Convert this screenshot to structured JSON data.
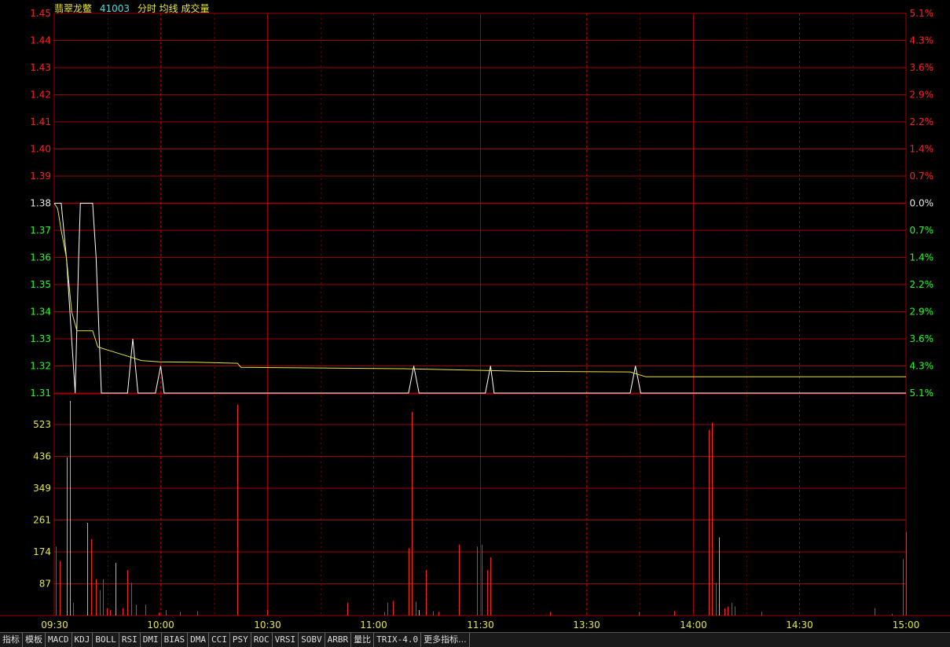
{
  "header": {
    "stock_name": "翡翠龙鳖",
    "stock_code": "41003",
    "legend_label": "分时 均线 成交量"
  },
  "colors": {
    "grid": "#a00000",
    "price_line": "#ffffff",
    "avg_line": "#e6e640",
    "up": "#ff2020",
    "down": "#20ff20",
    "neutral": "#e8e8e8",
    "volume_up": "#ff2020",
    "volume_down": "#40e0e0",
    "volume_label": "#e6e640",
    "time_label": "#e6e640"
  },
  "chart_data": [
    {
      "type": "line",
      "name": "price",
      "y_ticks_left": [
        "1.45",
        "1.44",
        "1.43",
        "1.42",
        "1.41",
        "1.40",
        "1.39",
        "1.38",
        "1.37",
        "1.36",
        "1.35",
        "1.34",
        "1.33",
        "1.32",
        "1.31"
      ],
      "y_ticks_right": [
        "5.1%",
        "4.3%",
        "3.6%",
        "2.9%",
        "2.2%",
        "1.4%",
        "0.7%",
        "0.0%",
        "0.7%",
        "1.4%",
        "2.2%",
        "2.9%",
        "3.6%",
        "4.3%",
        "5.1%"
      ],
      "ylim": [
        1.31,
        1.45
      ],
      "prev_close": 1.38,
      "x_ticks": [
        "09:30",
        "10:00",
        "10:30",
        "11:00",
        "11:30",
        "13:30",
        "14:00",
        "14:30",
        "15:00"
      ],
      "series": [
        {
          "name": "分时",
          "points": [
            [
              0,
              1.38
            ],
            [
              4,
              1.38
            ],
            [
              7,
              1.36
            ],
            [
              10,
              1.33
            ],
            [
              12,
              1.31
            ],
            [
              14,
              1.36
            ],
            [
              15,
              1.38
            ],
            [
              22,
              1.38
            ],
            [
              24,
              1.36
            ],
            [
              27,
              1.31
            ],
            [
              42,
              1.31
            ],
            [
              45,
              1.33
            ],
            [
              48,
              1.31
            ],
            [
              58,
              1.31
            ],
            [
              61,
              1.32
            ],
            [
              63,
              1.31
            ],
            [
              203,
              1.31
            ],
            [
              206,
              1.32
            ],
            [
              209,
              1.31
            ],
            [
              225,
              1.31
            ],
            [
              247,
              1.31
            ],
            [
              250,
              1.32
            ],
            [
              252,
              1.31
            ],
            [
              330,
              1.31
            ],
            [
              333,
              1.32
            ],
            [
              336,
              1.31
            ],
            [
              488,
              1.31
            ]
          ]
        },
        {
          "name": "均线",
          "points": [
            [
              0,
              1.38
            ],
            [
              2,
              1.378
            ],
            [
              4,
              1.37
            ],
            [
              7,
              1.36
            ],
            [
              10,
              1.34
            ],
            [
              13,
              1.333
            ],
            [
              22,
              1.333
            ],
            [
              25,
              1.327
            ],
            [
              30,
              1.326
            ],
            [
              40,
              1.324
            ],
            [
              50,
              1.322
            ],
            [
              60,
              1.3215
            ],
            [
              80,
              1.3214
            ],
            [
              105,
              1.321
            ],
            [
              107,
              1.3195
            ],
            [
              200,
              1.319
            ],
            [
              270,
              1.318
            ],
            [
              330,
              1.3178
            ],
            [
              339,
              1.316
            ],
            [
              488,
              1.316
            ]
          ]
        }
      ]
    },
    {
      "type": "bar",
      "name": "volume",
      "y_ticks": [
        "523",
        "436",
        "349",
        "261",
        "174",
        "87"
      ],
      "ylim": [
        0,
        590
      ],
      "bars": [
        {
          "x": 1,
          "v": 190,
          "dir": "up"
        },
        {
          "x": 3,
          "v": 150,
          "dir": "up"
        },
        {
          "x": 7,
          "v": 435,
          "dir": "down"
        },
        {
          "x": 9,
          "v": 590,
          "dir": "down"
        },
        {
          "x": 11,
          "v": 35,
          "dir": "up"
        },
        {
          "x": 19,
          "v": 255,
          "dir": "down"
        },
        {
          "x": 21,
          "v": 210,
          "dir": "up"
        },
        {
          "x": 24,
          "v": 100,
          "dir": "up"
        },
        {
          "x": 26,
          "v": 70,
          "dir": "up"
        },
        {
          "x": 28,
          "v": 100,
          "dir": "up"
        },
        {
          "x": 30,
          "v": 20,
          "dir": "up"
        },
        {
          "x": 32,
          "v": 15,
          "dir": "up"
        },
        {
          "x": 35,
          "v": 145,
          "dir": "down"
        },
        {
          "x": 39,
          "v": 20,
          "dir": "up"
        },
        {
          "x": 42,
          "v": 125,
          "dir": "up"
        },
        {
          "x": 44,
          "v": 90,
          "dir": "up"
        },
        {
          "x": 47,
          "v": 30,
          "dir": "up"
        },
        {
          "x": 52,
          "v": 30,
          "dir": "up"
        },
        {
          "x": 60,
          "v": 8,
          "dir": "up"
        },
        {
          "x": 64,
          "v": 15,
          "dir": "up"
        },
        {
          "x": 72,
          "v": 10,
          "dir": "up"
        },
        {
          "x": 82,
          "v": 12,
          "dir": "up"
        },
        {
          "x": 105,
          "v": 580,
          "dir": "up"
        },
        {
          "x": 122,
          "v": 15,
          "dir": "up"
        },
        {
          "x": 168,
          "v": 35,
          "dir": "up"
        },
        {
          "x": 189,
          "v": 10,
          "dir": "up"
        },
        {
          "x": 191,
          "v": 35,
          "dir": "up"
        },
        {
          "x": 194,
          "v": 40,
          "dir": "up"
        },
        {
          "x": 203,
          "v": 185,
          "dir": "up"
        },
        {
          "x": 205,
          "v": 560,
          "dir": "up"
        },
        {
          "x": 207,
          "v": 38,
          "dir": "up"
        },
        {
          "x": 209,
          "v": 15,
          "dir": "down"
        },
        {
          "x": 213,
          "v": 125,
          "dir": "up"
        },
        {
          "x": 217,
          "v": 12,
          "dir": "up"
        },
        {
          "x": 220,
          "v": 10,
          "dir": "up"
        },
        {
          "x": 232,
          "v": 195,
          "dir": "up"
        },
        {
          "x": 242,
          "v": 190,
          "dir": "up"
        },
        {
          "x": 245,
          "v": 195,
          "dir": "up"
        },
        {
          "x": 248,
          "v": 125,
          "dir": "up"
        },
        {
          "x": 250,
          "v": 160,
          "dir": "up"
        },
        {
          "x": 284,
          "v": 10,
          "dir": "up"
        },
        {
          "x": 335,
          "v": 10,
          "dir": "up"
        },
        {
          "x": 355,
          "v": 12,
          "dir": "up"
        },
        {
          "x": 375,
          "v": 510,
          "dir": "up"
        },
        {
          "x": 377,
          "v": 530,
          "dir": "up"
        },
        {
          "x": 379,
          "v": 90,
          "dir": "up"
        },
        {
          "x": 381,
          "v": 215,
          "dir": "down"
        },
        {
          "x": 384,
          "v": 20,
          "dir": "up"
        },
        {
          "x": 386,
          "v": 25,
          "dir": "up"
        },
        {
          "x": 388,
          "v": 35,
          "dir": "up"
        },
        {
          "x": 390,
          "v": 25,
          "dir": "up"
        },
        {
          "x": 405,
          "v": 10,
          "dir": "up"
        },
        {
          "x": 470,
          "v": 20,
          "dir": "up"
        },
        {
          "x": 480,
          "v": 5,
          "dir": "up"
        },
        {
          "x": 486,
          "v": 155,
          "dir": "up"
        },
        {
          "x": 488,
          "v": 230,
          "dir": "up"
        }
      ]
    }
  ],
  "tabs": [
    "指标",
    "模板",
    "MACD",
    "KDJ",
    "BOLL",
    "RSI",
    "DMI",
    "BIAS",
    "DMA",
    "CCI",
    "PSY",
    "ROC",
    "VRSI",
    "SOBV",
    "ARBR",
    "量比",
    "TRIX-4.0",
    "更多指标..."
  ]
}
